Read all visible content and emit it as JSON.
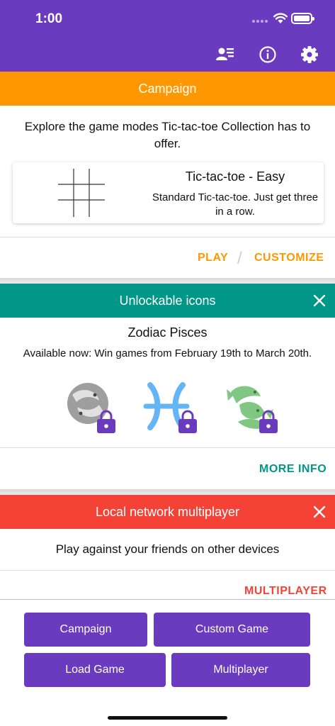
{
  "status_bar": {
    "time": "1:00"
  },
  "icons": {
    "contacts": "contacts-list-icon",
    "info": "info-icon",
    "settings": "gear-icon",
    "close": "close-icon",
    "lock": "lock-icon"
  },
  "campaign": {
    "header": "Campaign",
    "description": "Explore the game modes Tic-tac-toe Collection has to offer.",
    "mode_title": "Tic-tac-toe - Easy",
    "mode_description": "Standard Tic-tac-toe. Just get three in a row.",
    "play_label": "PLAY",
    "separator": "/",
    "customize_label": "CUSTOMIZE"
  },
  "unlockable": {
    "header": "Unlockable icons",
    "title": "Zodiac Pisces",
    "subtitle": "Available now: Win games from February 19th to March 20th.",
    "icon_names": [
      "pisces-fish-icon",
      "pisces-symbol-icon",
      "pisces-green-fish-icon"
    ],
    "more_info_label": "MORE INFO"
  },
  "local_network": {
    "header": "Local network multiplayer",
    "description": "Play against your friends on other devices",
    "multiplayer_label": "MULTIPLAYER"
  },
  "bottom_buttons": {
    "campaign": "Campaign",
    "custom_game": "Custom Game",
    "load_game": "Load Game",
    "multiplayer": "Multiplayer"
  },
  "colors": {
    "primary": "#6a3bbf",
    "campaign": "#ff9800",
    "unlockable": "#009688",
    "network": "#f44336",
    "grey_icon": "#9e9e9e",
    "blue_icon": "#64b5f6",
    "green_icon": "#81c784"
  }
}
